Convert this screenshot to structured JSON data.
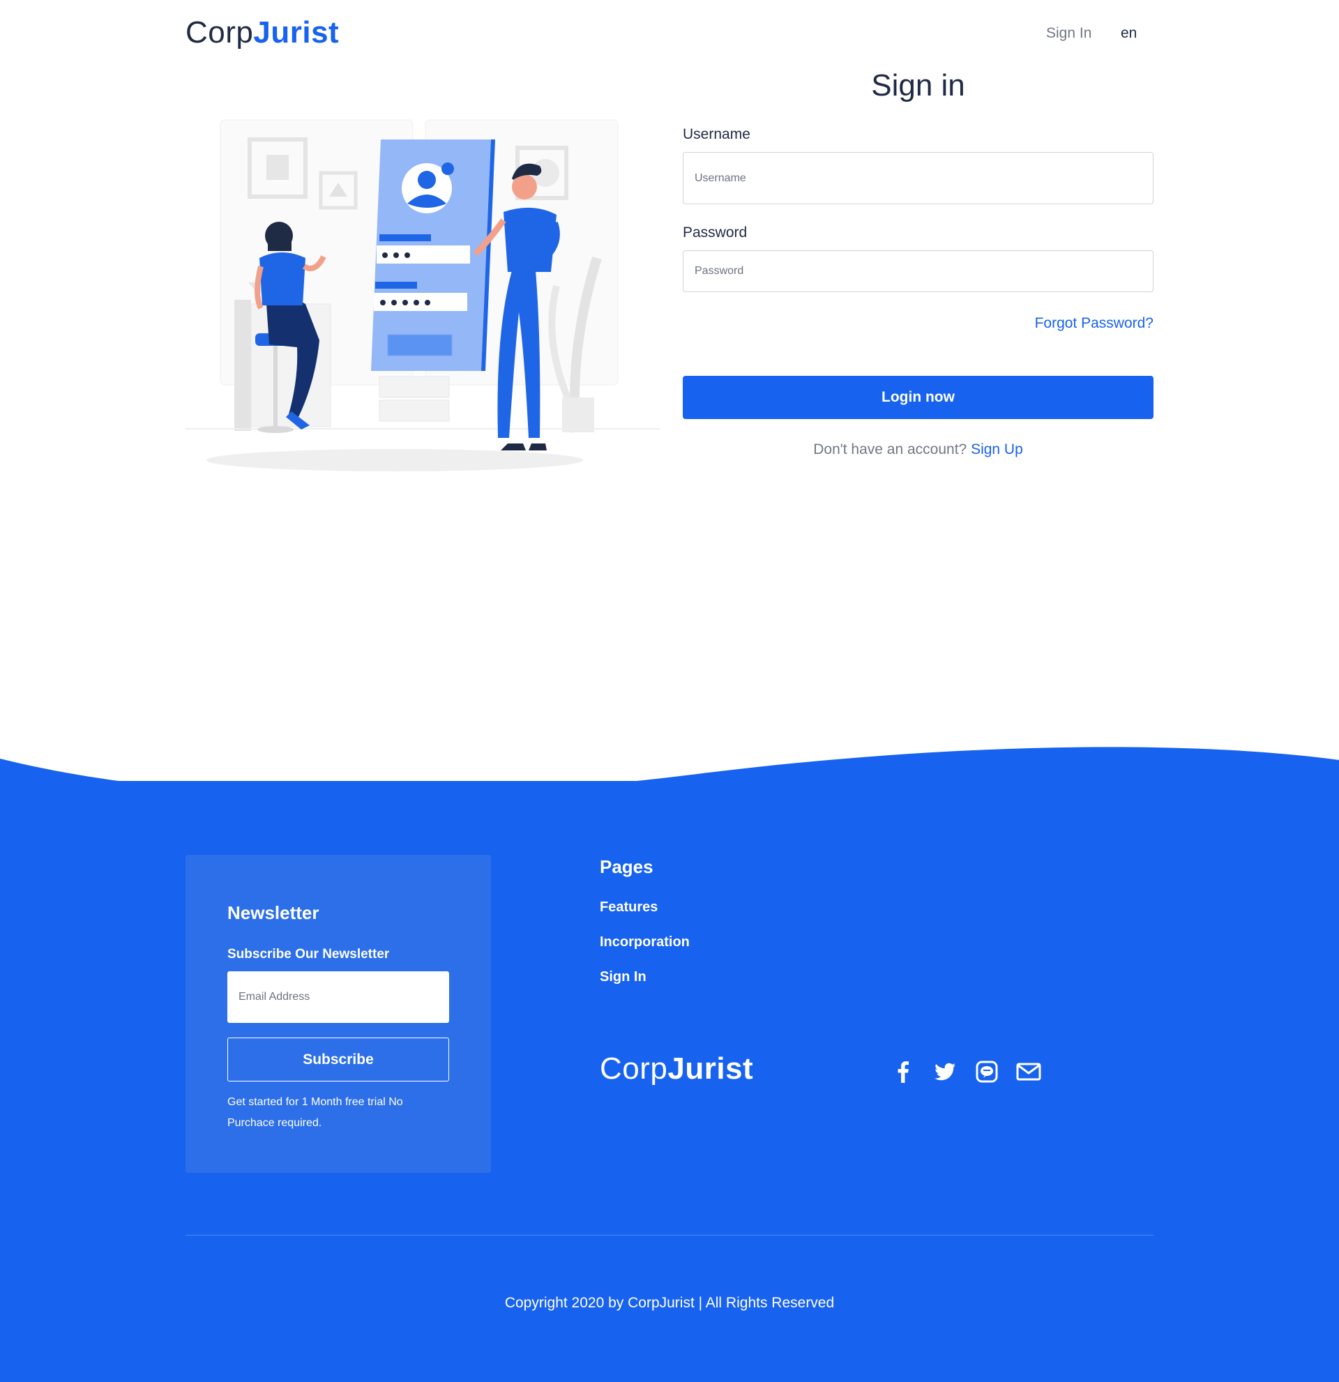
{
  "header": {
    "logo_light": "Corp",
    "logo_bold": "Jurist",
    "nav_signin": "Sign In",
    "nav_lang": "en"
  },
  "form": {
    "title": "Sign in",
    "username_label": "Username",
    "username_placeholder": "Username",
    "username_value": "",
    "password_label": "Password",
    "password_placeholder": "Password",
    "password_value": "",
    "forgot_label": "Forgot Password?",
    "login_label": "Login now",
    "signup_prompt": "Don't have an account?",
    "signup_link": "Sign Up"
  },
  "footer": {
    "newsletter": {
      "title": "Newsletter",
      "subtitle": "Subscribe Our Newsletter",
      "email_placeholder": "Email Address",
      "subscribe_label": "Subscribe",
      "note": "Get started for 1 Month free trial No Purchace required."
    },
    "pages": {
      "title": "Pages",
      "links": [
        "Features",
        "Incorporation",
        "Sign In"
      ]
    },
    "logo_light": "Corp",
    "logo_bold": "Jurist",
    "social_icons": [
      "facebook-icon",
      "twitter-icon",
      "line-icon",
      "mail-icon"
    ],
    "copyright": "Copyright 2020 by CorpJurist | All Rights Reserved"
  },
  "colors": {
    "brand_blue": "#1762ee",
    "newsletter_panel": "#2c6fe8",
    "text_dark": "#1f2a44",
    "text_muted": "#707784"
  }
}
